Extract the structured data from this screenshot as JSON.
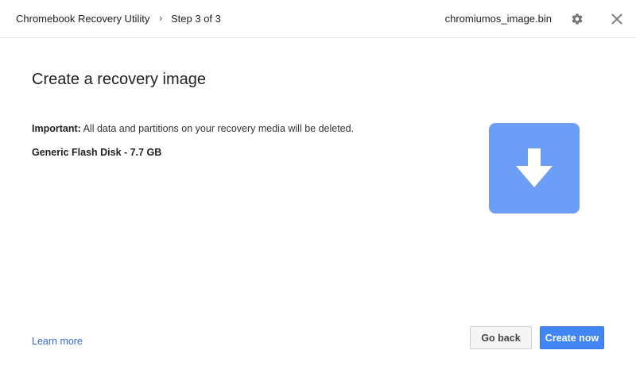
{
  "header": {
    "app_title": "Chromebook Recovery Utility",
    "step_chevron": "›",
    "step_label": "Step 3 of 3",
    "file_name": "chromiumos_image.bin",
    "settings_icon": "gear-icon",
    "close_icon": "close-icon"
  },
  "main": {
    "title": "Create a recovery image",
    "warning_prefix": "Important:",
    "warning_text": " All data and partitions on your recovery media will be deleted.",
    "device_label": "Generic Flash Disk - 7.7 GB",
    "hero_icon": "download-arrow-icon"
  },
  "footer": {
    "learn_more": "Learn more",
    "back_label": "Go back",
    "create_label": "Create now"
  },
  "colors": {
    "accent": "#4285f4",
    "hero_tile": "#6c9ef8",
    "link": "#3367d6"
  }
}
